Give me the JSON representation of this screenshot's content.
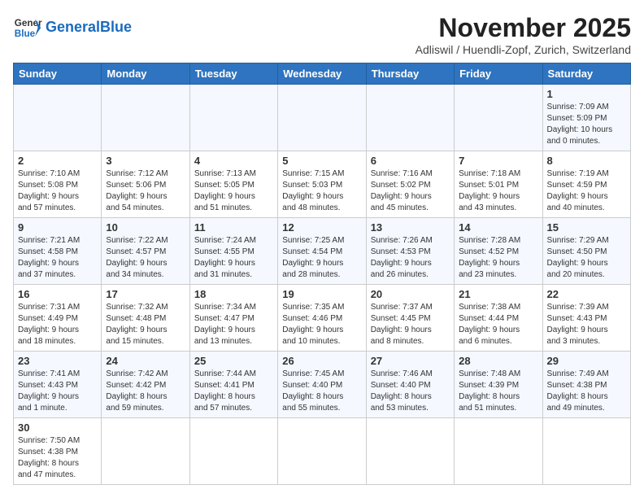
{
  "logo": {
    "general": "General",
    "blue": "Blue"
  },
  "header": {
    "title": "November 2025",
    "subtitle": "Adliswil / Huendli-Zopf, Zurich, Switzerland"
  },
  "weekdays": [
    "Sunday",
    "Monday",
    "Tuesday",
    "Wednesday",
    "Thursday",
    "Friday",
    "Saturday"
  ],
  "weeks": [
    {
      "days": [
        {
          "num": "",
          "info": ""
        },
        {
          "num": "",
          "info": ""
        },
        {
          "num": "",
          "info": ""
        },
        {
          "num": "",
          "info": ""
        },
        {
          "num": "",
          "info": ""
        },
        {
          "num": "",
          "info": ""
        },
        {
          "num": "1",
          "info": "Sunrise: 7:09 AM\nSunset: 5:09 PM\nDaylight: 10 hours\nand 0 minutes."
        }
      ]
    },
    {
      "days": [
        {
          "num": "2",
          "info": "Sunrise: 7:10 AM\nSunset: 5:08 PM\nDaylight: 9 hours\nand 57 minutes."
        },
        {
          "num": "3",
          "info": "Sunrise: 7:12 AM\nSunset: 5:06 PM\nDaylight: 9 hours\nand 54 minutes."
        },
        {
          "num": "4",
          "info": "Sunrise: 7:13 AM\nSunset: 5:05 PM\nDaylight: 9 hours\nand 51 minutes."
        },
        {
          "num": "5",
          "info": "Sunrise: 7:15 AM\nSunset: 5:03 PM\nDaylight: 9 hours\nand 48 minutes."
        },
        {
          "num": "6",
          "info": "Sunrise: 7:16 AM\nSunset: 5:02 PM\nDaylight: 9 hours\nand 45 minutes."
        },
        {
          "num": "7",
          "info": "Sunrise: 7:18 AM\nSunset: 5:01 PM\nDaylight: 9 hours\nand 43 minutes."
        },
        {
          "num": "8",
          "info": "Sunrise: 7:19 AM\nSunset: 4:59 PM\nDaylight: 9 hours\nand 40 minutes."
        }
      ]
    },
    {
      "days": [
        {
          "num": "9",
          "info": "Sunrise: 7:21 AM\nSunset: 4:58 PM\nDaylight: 9 hours\nand 37 minutes."
        },
        {
          "num": "10",
          "info": "Sunrise: 7:22 AM\nSunset: 4:57 PM\nDaylight: 9 hours\nand 34 minutes."
        },
        {
          "num": "11",
          "info": "Sunrise: 7:24 AM\nSunset: 4:55 PM\nDaylight: 9 hours\nand 31 minutes."
        },
        {
          "num": "12",
          "info": "Sunrise: 7:25 AM\nSunset: 4:54 PM\nDaylight: 9 hours\nand 28 minutes."
        },
        {
          "num": "13",
          "info": "Sunrise: 7:26 AM\nSunset: 4:53 PM\nDaylight: 9 hours\nand 26 minutes."
        },
        {
          "num": "14",
          "info": "Sunrise: 7:28 AM\nSunset: 4:52 PM\nDaylight: 9 hours\nand 23 minutes."
        },
        {
          "num": "15",
          "info": "Sunrise: 7:29 AM\nSunset: 4:50 PM\nDaylight: 9 hours\nand 20 minutes."
        }
      ]
    },
    {
      "days": [
        {
          "num": "16",
          "info": "Sunrise: 7:31 AM\nSunset: 4:49 PM\nDaylight: 9 hours\nand 18 minutes."
        },
        {
          "num": "17",
          "info": "Sunrise: 7:32 AM\nSunset: 4:48 PM\nDaylight: 9 hours\nand 15 minutes."
        },
        {
          "num": "18",
          "info": "Sunrise: 7:34 AM\nSunset: 4:47 PM\nDaylight: 9 hours\nand 13 minutes."
        },
        {
          "num": "19",
          "info": "Sunrise: 7:35 AM\nSunset: 4:46 PM\nDaylight: 9 hours\nand 10 minutes."
        },
        {
          "num": "20",
          "info": "Sunrise: 7:37 AM\nSunset: 4:45 PM\nDaylight: 9 hours\nand 8 minutes."
        },
        {
          "num": "21",
          "info": "Sunrise: 7:38 AM\nSunset: 4:44 PM\nDaylight: 9 hours\nand 6 minutes."
        },
        {
          "num": "22",
          "info": "Sunrise: 7:39 AM\nSunset: 4:43 PM\nDaylight: 9 hours\nand 3 minutes."
        }
      ]
    },
    {
      "days": [
        {
          "num": "23",
          "info": "Sunrise: 7:41 AM\nSunset: 4:43 PM\nDaylight: 9 hours\nand 1 minute."
        },
        {
          "num": "24",
          "info": "Sunrise: 7:42 AM\nSunset: 4:42 PM\nDaylight: 8 hours\nand 59 minutes."
        },
        {
          "num": "25",
          "info": "Sunrise: 7:44 AM\nSunset: 4:41 PM\nDaylight: 8 hours\nand 57 minutes."
        },
        {
          "num": "26",
          "info": "Sunrise: 7:45 AM\nSunset: 4:40 PM\nDaylight: 8 hours\nand 55 minutes."
        },
        {
          "num": "27",
          "info": "Sunrise: 7:46 AM\nSunset: 4:40 PM\nDaylight: 8 hours\nand 53 minutes."
        },
        {
          "num": "28",
          "info": "Sunrise: 7:48 AM\nSunset: 4:39 PM\nDaylight: 8 hours\nand 51 minutes."
        },
        {
          "num": "29",
          "info": "Sunrise: 7:49 AM\nSunset: 4:38 PM\nDaylight: 8 hours\nand 49 minutes."
        }
      ]
    },
    {
      "days": [
        {
          "num": "30",
          "info": "Sunrise: 7:50 AM\nSunset: 4:38 PM\nDaylight: 8 hours\nand 47 minutes."
        },
        {
          "num": "",
          "info": ""
        },
        {
          "num": "",
          "info": ""
        },
        {
          "num": "",
          "info": ""
        },
        {
          "num": "",
          "info": ""
        },
        {
          "num": "",
          "info": ""
        },
        {
          "num": "",
          "info": ""
        }
      ]
    }
  ]
}
